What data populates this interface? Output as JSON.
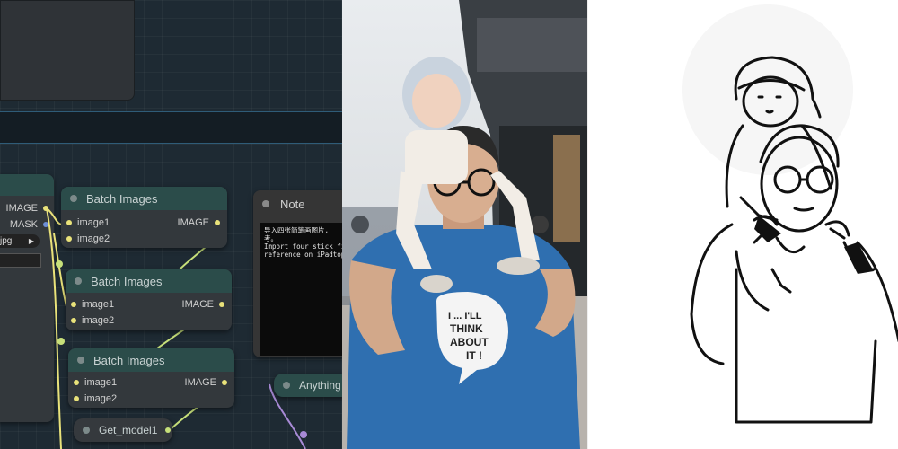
{
  "canvas": {
    "loader_node": {
      "outputs": [
        "IMAGE",
        "MASK"
      ],
      "file_value": "jpg"
    },
    "batch_nodes": [
      {
        "title": "Batch Images",
        "inputs": [
          "image1",
          "image2"
        ],
        "output": "IMAGE"
      },
      {
        "title": "Batch Images",
        "inputs": [
          "image1",
          "image2"
        ],
        "output": "IMAGE"
      },
      {
        "title": "Batch Images",
        "inputs": [
          "image1",
          "image2"
        ],
        "output": "IMAGE"
      }
    ],
    "note": {
      "title": "Note",
      "text_line1": "导入四张简笔画图片,",
      "text_line2": "考。",
      "text_line3": "Import four stick fi",
      "text_line4": "reference on iPadtop"
    },
    "get_model_node": {
      "title": "Get_model1"
    },
    "anything_node": {
      "title": "Anything"
    }
  },
  "photo": {
    "shirt_text": [
      "I ... I'LL",
      "THINK",
      "ABOUT",
      "IT !"
    ]
  },
  "colors": {
    "canvas_bg": "#1e2a33",
    "node_header": "#2b4c4a",
    "image_wire": "#e9e27a",
    "model_wire": "#c7e07a",
    "mask_slot": "#6e8fd6",
    "shirt_blue": "#2f6fb0"
  }
}
